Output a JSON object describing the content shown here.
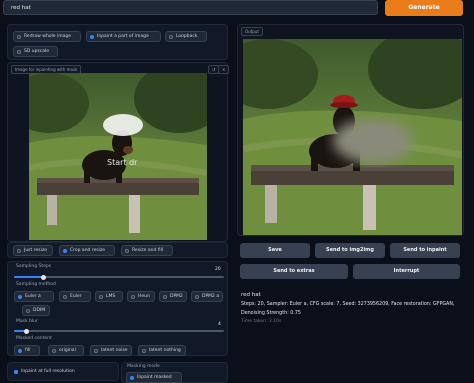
{
  "prompt": {
    "value": "red hat"
  },
  "generate_label": "Generate",
  "mode_options": [
    {
      "label": "Redraw whole image",
      "selected": false
    },
    {
      "label": "Inpaint a part of image",
      "selected": true
    },
    {
      "label": "Loopback",
      "selected": false
    },
    {
      "label": "SD upscale",
      "selected": false
    }
  ],
  "input_image": {
    "label": "Image for inpainting with mask",
    "overlay_text": "Start dr",
    "tools": [
      "↺",
      "✕"
    ]
  },
  "resize_options": [
    {
      "label": "Just resize",
      "selected": false
    },
    {
      "label": "Crop and resize",
      "selected": true
    },
    {
      "label": "Resize and fill",
      "selected": false
    }
  ],
  "sampling_steps": {
    "label": "Sampling Steps",
    "value": "20",
    "fraction": 0.14
  },
  "sampling_method": {
    "label": "Sampling method",
    "options": [
      {
        "label": "Euler a",
        "selected": true
      },
      {
        "label": "Euler",
        "selected": false
      },
      {
        "label": "LMS",
        "selected": false
      },
      {
        "label": "Heun",
        "selected": false
      },
      {
        "label": "DPM2",
        "selected": false
      },
      {
        "label": "DPM2 a",
        "selected": false
      },
      {
        "label": "DDIM",
        "selected": false
      }
    ]
  },
  "mask_blur": {
    "label": "Mask blur",
    "value": "4",
    "fraction": 0.06
  },
  "masked_content": {
    "label": "Masked content",
    "options": [
      {
        "label": "fill",
        "selected": true
      },
      {
        "label": "original",
        "selected": false
      },
      {
        "label": "latent noise",
        "selected": false
      },
      {
        "label": "latent nothing",
        "selected": false
      }
    ]
  },
  "inpaint_full_res": {
    "label": "Inpaint at full resolution",
    "checked": true
  },
  "masking_mode": {
    "label": "Masking mode",
    "options": [
      {
        "label": "Inpaint masked",
        "selected": true
      }
    ]
  },
  "output": {
    "label": "Output",
    "buttons": [
      "Save",
      "Send to img2img",
      "Send to inpaint",
      "Send to extras",
      "Interrupt"
    ],
    "info_title": "red hat",
    "info_line1": "Steps: 20, Sampler: Euler a, CFG scale: 7, Seed: 3273956209, Face restoration: GFPGAN,",
    "info_line2": "Denoising Strength: 0.75",
    "info_time": "Time taken: 2.10s"
  },
  "colors": {
    "accent_orange": "#ea7c1a",
    "accent_blue": "#3b82f6",
    "background": "#0b0f19"
  }
}
